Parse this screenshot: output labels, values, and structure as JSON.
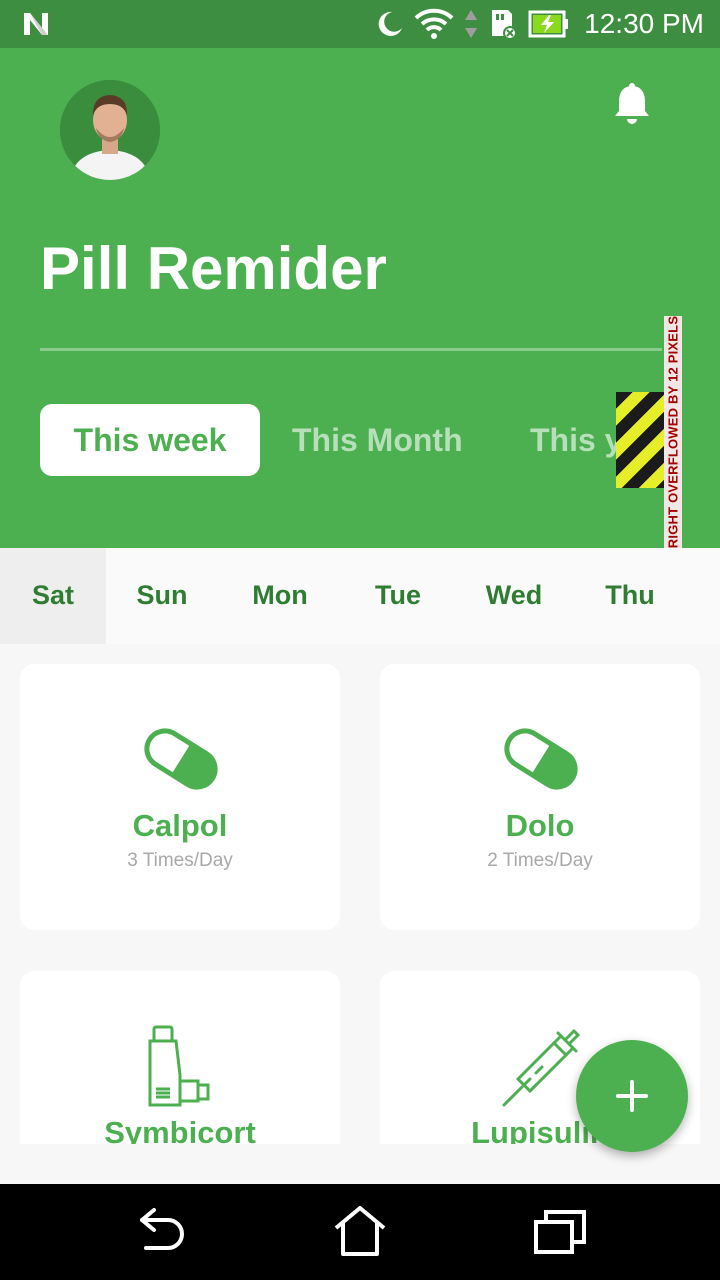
{
  "status_bar": {
    "time": "12:30 PM",
    "icons": [
      "n-logo-icon",
      "moon-icon",
      "wifi-icon",
      "data-arrows-icon",
      "sd-card-icon",
      "battery-charging-icon"
    ]
  },
  "header": {
    "title": "Pill Remider",
    "tabs": [
      {
        "label": "This week",
        "active": true
      },
      {
        "label": "This Month",
        "active": false
      },
      {
        "label": "This year",
        "active": false
      }
    ],
    "overflow_warning": "RIGHT OVERFLOWED BY 12 PIXELS",
    "colors": {
      "primary": "#4caf50",
      "status_bar": "#3e8e41"
    }
  },
  "days": {
    "items": [
      "Sat",
      "Sun",
      "Mon",
      "Tue",
      "Wed",
      "Thu"
    ],
    "selected": "Sat"
  },
  "medicines": [
    {
      "name": "Calpol",
      "frequency": "3 Times/Day",
      "icon": "pill-capsule-icon"
    },
    {
      "name": "Dolo",
      "frequency": "2 Times/Day",
      "icon": "pill-capsule-icon"
    },
    {
      "name": "Symbicort",
      "frequency": "",
      "icon": "inhaler-icon"
    },
    {
      "name": "Lupisulin",
      "frequency": "",
      "icon": "syringe-icon"
    }
  ],
  "fab": {
    "icon": "plus-icon"
  },
  "navbar": {
    "icons": [
      "back-icon",
      "home-icon",
      "recents-icon"
    ]
  }
}
